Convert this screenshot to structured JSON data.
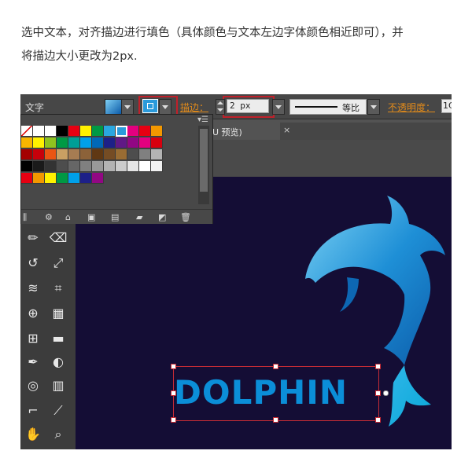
{
  "instruction": {
    "line1": "选中文本，对齐描边进行填色（具体颜色与文本左边字体颜色相近即可），并",
    "line2": "将描边大小更改为2px."
  },
  "control_bar": {
    "mode_label": "文字",
    "stroke_label": "描边：",
    "stroke_value": "2 px",
    "profile_label": "等比",
    "opacity_label": "不透明度：",
    "opacity_value": "1C"
  },
  "tab": {
    "label": "U 预览)",
    "close": "×"
  },
  "panel": {
    "tools": [
      "lib-icon",
      "swatch-options-icon",
      "group-icon",
      "swatch-kind-icon",
      "list-icon",
      "folder-icon",
      "new-icon",
      "trash-icon"
    ]
  },
  "canvas": {
    "word": "DOLPHIN"
  },
  "colors": {
    "background": "#140d35",
    "highlight": "#c0202a",
    "text_fill": "#0b8ed8"
  }
}
